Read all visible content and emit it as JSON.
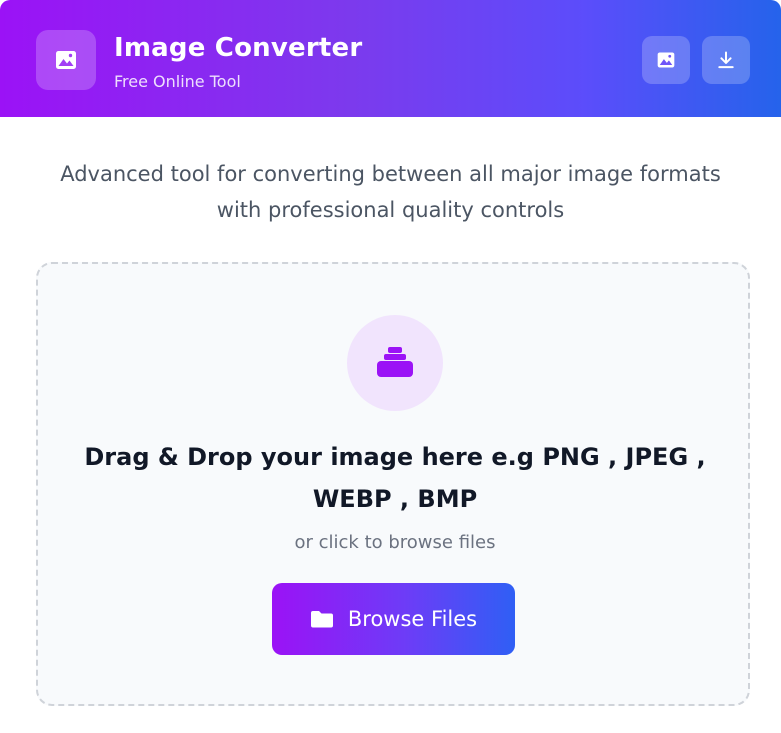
{
  "header": {
    "title": "Image Converter",
    "subtitle": "Free Online Tool",
    "logo_icon": "image-icon",
    "actions": [
      {
        "icon": "image-icon"
      },
      {
        "icon": "download-icon"
      }
    ]
  },
  "description": "Advanced tool for converting between all major image formats with professional quality controls",
  "dropzone": {
    "icon": "upload-stack-icon",
    "title": "Drag & Drop your image here e.g PNG , JPEG , WEBP , BMP",
    "subtitle": "or click to browse files",
    "button_label": "Browse Files",
    "button_icon": "folder-icon"
  },
  "colors": {
    "accent_purple": "#9b12f6",
    "accent_blue": "#2563eb",
    "icon_purple": "#9b12f6"
  }
}
